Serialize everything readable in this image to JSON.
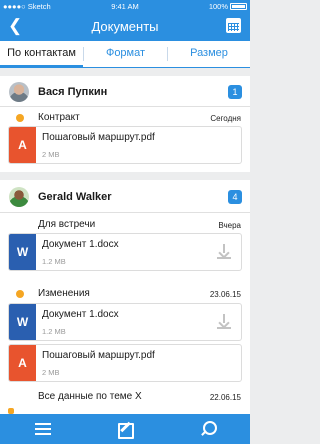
{
  "status": {
    "carrier": "Sketch",
    "time": "9:41 AM",
    "battery": "100%"
  },
  "header": {
    "title": "Документы",
    "back_icon": "chevron-left-icon",
    "calendar_icon": "calendar-icon"
  },
  "tabs": [
    {
      "label": "По контактам",
      "active": true
    },
    {
      "label": "Формат",
      "active": false
    },
    {
      "label": "Размер",
      "active": false
    }
  ],
  "contacts": [
    {
      "name": "Вася Пупкин",
      "count": "1",
      "groups": [
        {
          "title": "Контракт",
          "date": "Сегодня",
          "unread": true,
          "files": [
            {
              "name": "Пошаговый маршрут.pdf",
              "size": "2 MB",
              "type": "pdf"
            }
          ]
        }
      ]
    },
    {
      "name": "Gerald Walker",
      "count": "4",
      "groups": [
        {
          "title": "Для встречи",
          "date": "Вчера",
          "unread": false,
          "files": [
            {
              "name": "Документ 1.docx",
              "size": "1.2 MB",
              "type": "doc"
            }
          ]
        },
        {
          "title": "Изменения",
          "date": "23.06.15",
          "unread": true,
          "files": [
            {
              "name": "Документ 1.docx",
              "size": "1.2 MB",
              "type": "doc"
            },
            {
              "name": "Пошаговый маршрут.pdf",
              "size": "2 MB",
              "type": "pdf"
            }
          ]
        },
        {
          "title": "Все данные по теме X",
          "date": "22.06.15",
          "unread": false,
          "files": []
        }
      ]
    }
  ],
  "icons": {
    "pdf": "A",
    "doc": "W"
  },
  "colors": {
    "accent": "#2b8fe0",
    "pdf": "#e8542e",
    "doc": "#2a5fb0",
    "unread": "#f5a623"
  },
  "bottom_bar": {
    "icons": [
      "menu-icon",
      "compose-icon",
      "search-icon"
    ]
  }
}
